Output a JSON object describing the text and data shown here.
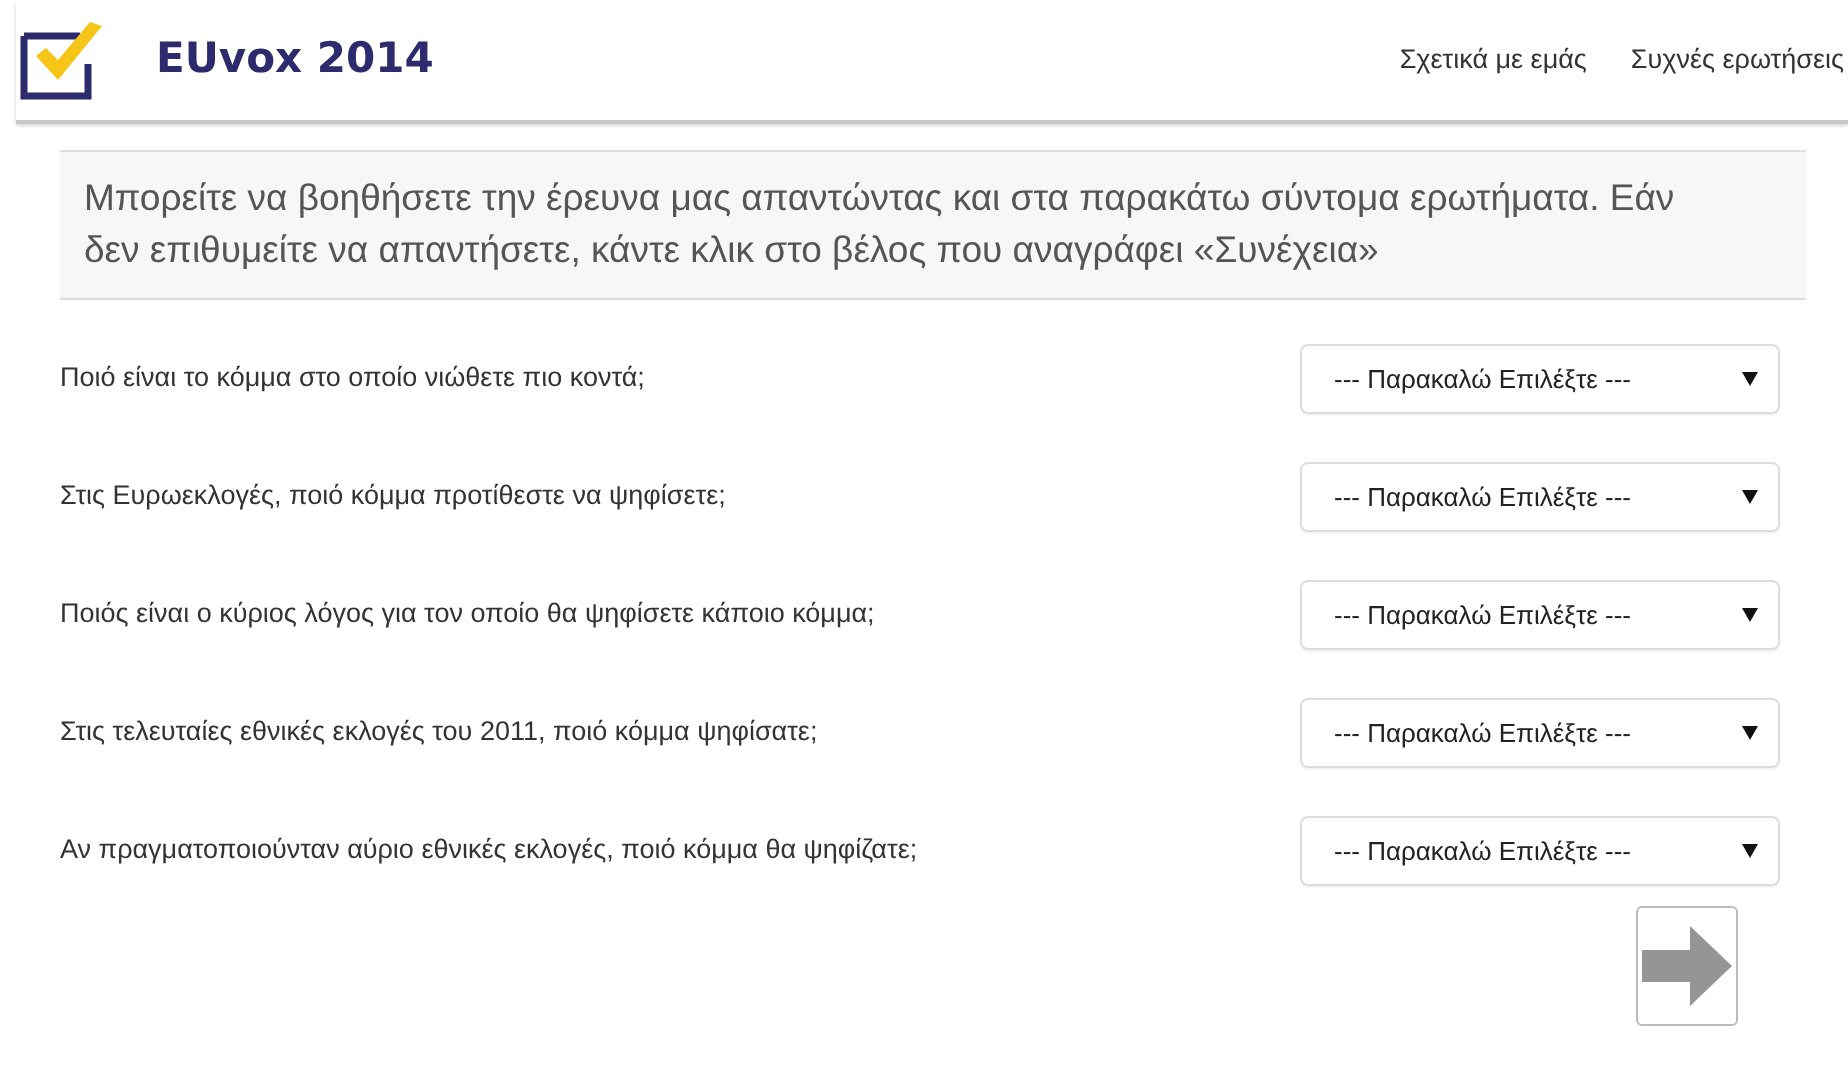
{
  "header": {
    "title": "EUvox 2014",
    "nav": [
      "Σχετικά με εμάς",
      "Συχνές ερωτήσεις"
    ]
  },
  "intro": "Μπορείτε να βοηθήσετε την έρευνα μας απαντώντας και στα παρακάτω σύντομα ερωτήματα. Εάν δεν επιθυμείτε να απαντήσετε, κάντε κλικ στο βέλος που αναγράφει «Συνέχεια»",
  "questions": [
    {
      "label": "Ποιό είναι το κόμμα στο οποίο νιώθετε πιο κοντά;",
      "value": "--- Παρακαλώ Επιλέξτε ---"
    },
    {
      "label": "Στις Ευρωεκλογές, ποιό κόμμα προτίθεστε να ψηφίσετε;",
      "value": "--- Παρακαλώ Επιλέξτε ---"
    },
    {
      "label": "Ποιός είναι ο κύριος λόγος για τον οποίο θα ψηφίσετε κάποιο κόμμα;",
      "value": "--- Παρακαλώ Επιλέξτε ---"
    },
    {
      "label": "Στις τελευταίες εθνικές εκλογές του 2011, ποιό κόμμα ψηφίσατε;",
      "value": "--- Παρακαλώ Επιλέξτε ---"
    },
    {
      "label": "Αν πραγματοποιούνταν αύριο εθνικές εκλογές, ποιό κόμμα θα ψηφίζατε;",
      "value": "--- Παρακαλώ Επιλέξτε ---"
    }
  ]
}
